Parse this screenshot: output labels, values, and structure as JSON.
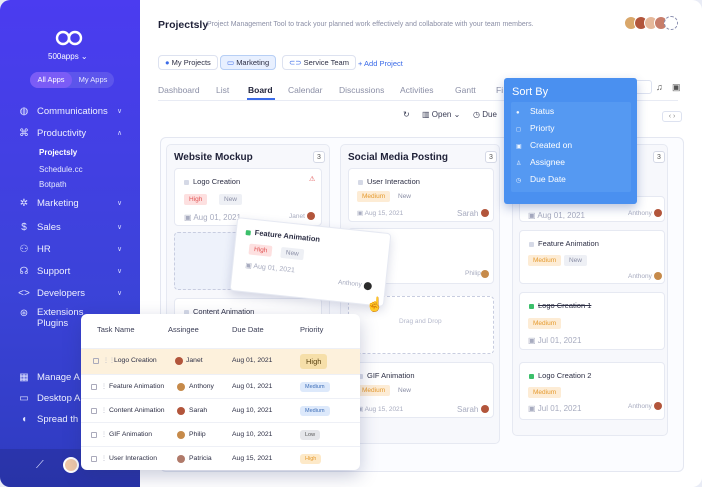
{
  "sidebar": {
    "org_name": "500apps ⌄",
    "pills": [
      "All Apps",
      "My Apps"
    ],
    "nav": [
      {
        "label": "Communications",
        "icon": "globe-icon"
      },
      {
        "label": "Productivity",
        "icon": "command-icon"
      },
      {
        "label": "Marketing",
        "icon": "gear-icon"
      },
      {
        "label": "Sales",
        "icon": "dollar-icon"
      },
      {
        "label": "HR",
        "icon": "users-icon"
      },
      {
        "label": "Support",
        "icon": "headset-icon"
      },
      {
        "label": "Developers",
        "icon": "code-icon"
      },
      {
        "label": "Extensions",
        "label2": "Plugins",
        "icon": "extension-icon"
      },
      {
        "label": "Manage A",
        "icon": "grid-icon"
      },
      {
        "label": "Desktop A",
        "icon": "monitor-icon"
      },
      {
        "label": "Spread th",
        "icon": "megaphone-icon"
      }
    ],
    "sub_items": [
      "Projectsly",
      "Schedule.cc",
      "Botpath"
    ]
  },
  "header": {
    "title": "Projectsly",
    "subtitle": "Project Management Tool to track your planned work effectively and collaborate with your team members."
  },
  "project_tabs": [
    "My Projects",
    "Marketing",
    "Service Team"
  ],
  "add_project": "+ Add Project",
  "view_tabs": [
    "Dashboard",
    "List",
    "Board",
    "Calendar",
    "Discussions",
    "Activities",
    "Gantt",
    "Fi"
  ],
  "toolbar": {
    "open": "Open ⌄",
    "due": "Due"
  },
  "columns": [
    {
      "title": "Website Mockup",
      "count": "3"
    },
    {
      "title": "Social Media Posting",
      "count": "3"
    },
    {
      "title": "",
      "count": "3"
    }
  ],
  "cards": {
    "logo_creation": {
      "title": "Logo Creation",
      "priority": "High",
      "status": "New",
      "date": "Aug 01, 2021",
      "owner": "Janet"
    },
    "content_animation": {
      "title": "Content Animation"
    },
    "user_interaction": {
      "title": "User Interaction",
      "priority": "Medium",
      "status": "New",
      "date": "Aug 15, 2021",
      "owner": "Sarah"
    },
    "philip_card": {
      "owner": "Philip"
    },
    "drag_drop": "Drag and Drop",
    "gif_animation": {
      "title": "GIF Animation",
      "priority": "Medium",
      "status": "New",
      "date": "Aug 15, 2021",
      "owner": "Sarah"
    },
    "col3_a": {
      "date": "Aug 01, 2021",
      "owner": "Anthony"
    },
    "feature_animation_b": {
      "title": "Feature Animation",
      "priority": "Medium",
      "status": "New",
      "owner": "Anthony"
    },
    "logo_creation_1": {
      "title": "Logo Creation 1",
      "priority": "Medium",
      "date": "Jul 01, 2021"
    },
    "logo_creation_2": {
      "title": "Logo Creation 2",
      "priority": "Medium",
      "date": "Jul 01, 2021",
      "owner": "Anthony"
    },
    "dragging": {
      "title": "Feature Animation",
      "priority": "High",
      "status": "New",
      "date": "Aug 01, 2021",
      "owner": "Anthony"
    }
  },
  "sort_panel": {
    "title": "Sort By",
    "options": [
      "Status",
      "Priorty",
      "Created on",
      "Assignee",
      "Due Date"
    ]
  },
  "task_table": {
    "headers": [
      "Task Name",
      "Assingee",
      "Due Date",
      "Priority"
    ],
    "rows": [
      {
        "task": "Logo Creation",
        "assignee": "Janet",
        "due": "Aug 01, 2021",
        "priority": "High"
      },
      {
        "task": "Feature Animation",
        "assignee": "Anthony",
        "due": "Aug 01, 2021",
        "priority": "Medium"
      },
      {
        "task": "Content Animation",
        "assignee": "Sarah",
        "due": "Aug 10, 2021",
        "priority": "Medium"
      },
      {
        "task": "GIF Animation",
        "assignee": "Philip",
        "due": "Aug 10, 2021",
        "priority": "Low"
      },
      {
        "task": "User Interaction",
        "assignee": "Patricia",
        "due": "Aug 15, 2021",
        "priority": "High"
      }
    ]
  },
  "colors": {
    "accent": "#3b6be8",
    "sidebar": "#4b3cf0",
    "sort_panel": "#4a90f0"
  }
}
